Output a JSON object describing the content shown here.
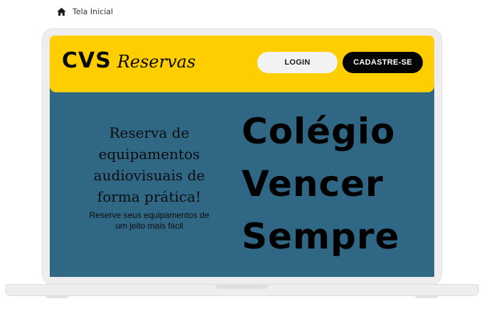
{
  "breadcrumb": {
    "icon": "home-icon",
    "label": "Tela Inicial"
  },
  "header": {
    "logo_main": "CVS",
    "logo_script": "Reservas",
    "login_label": "LOGIN",
    "signup_label": "CADASTRE-SE"
  },
  "hero": {
    "headline": "Reserva de equipamentos audiovisuais de forma prática!",
    "subtitle": "Reserve seus equipamentos de um jeito mais fácil",
    "school_name": [
      "Colégio",
      "Vencer",
      "Sempre"
    ]
  },
  "colors": {
    "header_bg": "#ffce00",
    "hero_bg": "#2f6784",
    "signup_bg": "#050505",
    "login_bg": "#f2f2f2",
    "device_frame": "#efeded"
  }
}
